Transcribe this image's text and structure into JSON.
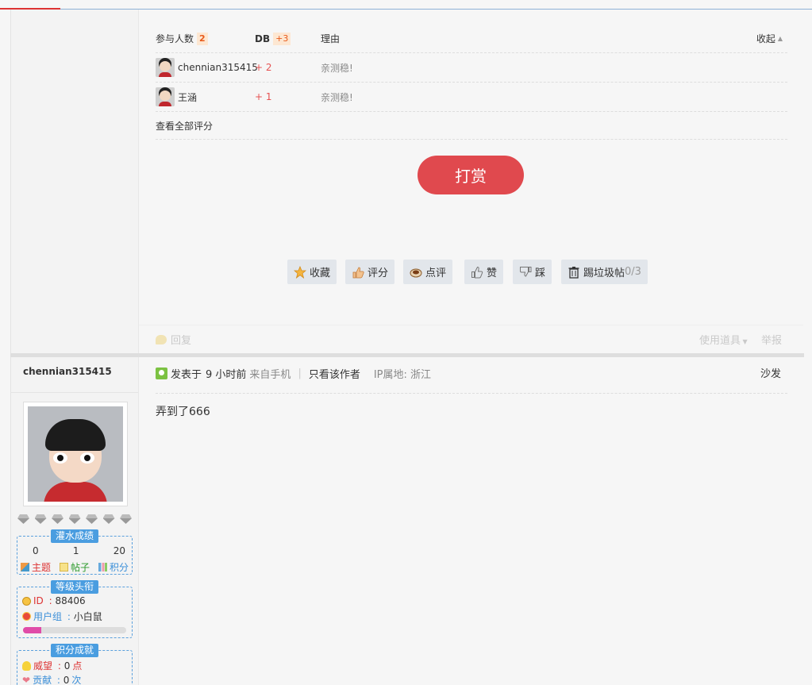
{
  "rate": {
    "header": {
      "participants_label": "参与人数",
      "participants_count": "2",
      "db_label": "DB",
      "db_total": "+3",
      "reason_label": "理由",
      "collapse_label": "收起"
    },
    "rows": [
      {
        "user": "chennian315415",
        "score": "+ 2",
        "reason": "亲测稳!"
      },
      {
        "user": "王涵",
        "score": "+ 1",
        "reason": "亲测稳!"
      }
    ],
    "view_all": "查看全部评分"
  },
  "reward_button": "打赏",
  "actions": {
    "favorite": "收藏",
    "rate": "评分",
    "comment": "点评",
    "like": "赞",
    "dislike": "踩",
    "trash": "踢垃圾帖",
    "trash_count": "0/3"
  },
  "reply_bar": {
    "reply": "回复",
    "use_tool": "使用道具",
    "report": "举报"
  },
  "post2": {
    "author": "chennian315415",
    "meta": {
      "posted_prefix": "发表于",
      "time": "9 小时前",
      "source": "来自手机",
      "only_author": "只看该作者",
      "ip_label": "IP属地: 浙江"
    },
    "floor": "沙发",
    "content": "弄到了666"
  },
  "profile": {
    "water_title": "灌水成绩",
    "topics": "0",
    "posts": "1",
    "credits": "20",
    "topics_label": "主题",
    "posts_label": "帖子",
    "credits_label": "积分",
    "level_title": "等级头衔",
    "id_label": "ID",
    "id_value": "88406",
    "group_label": "用户组",
    "group_value": "小白鼠",
    "progress": 0.18,
    "score_title": "积分成就",
    "prestige_label": "威望",
    "prestige_value": "0",
    "prestige_unit": "点",
    "contrib_label": "贡献",
    "contrib_value": "0",
    "contrib_unit": "次"
  },
  "colors": {
    "accent_red": "#e0494e",
    "link_blue": "#3b8fd8",
    "score_red": "#e65252"
  }
}
